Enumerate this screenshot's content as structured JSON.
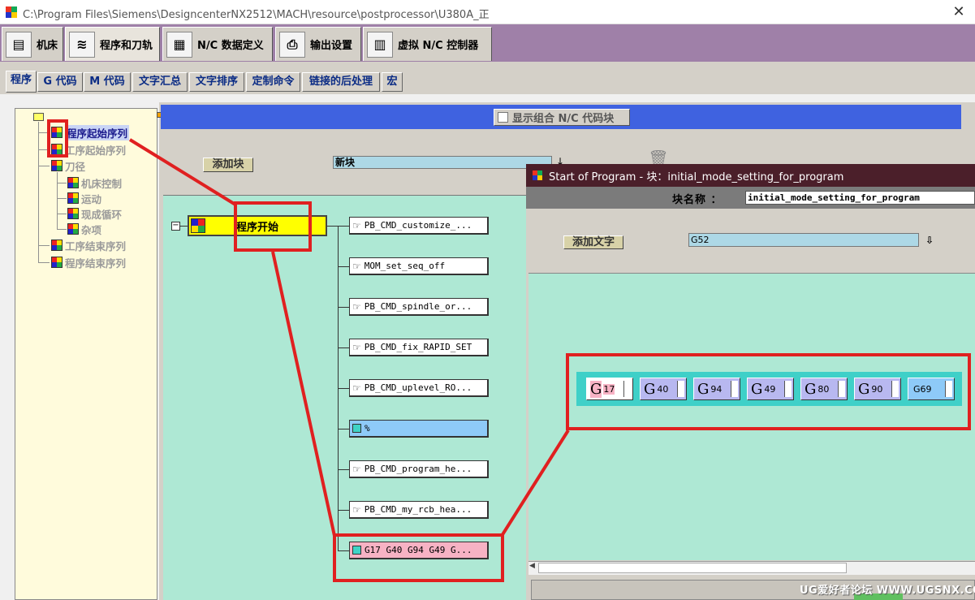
{
  "window": {
    "title": "C:\\Program Files\\Siemens\\DesigncenterNX2512\\MACH\\resource\\postprocessor\\U380A_正",
    "close": "✕"
  },
  "main_tabs": [
    {
      "label": "机床",
      "icon": "machine-icon"
    },
    {
      "label": "程序和刀轨",
      "icon": "program-path-icon"
    },
    {
      "label": "N/C 数据定义",
      "icon": "nc-data-icon"
    },
    {
      "label": "输出设置",
      "icon": "printer-icon"
    },
    {
      "label": "虚拟 N/C 控制器",
      "icon": "virtual-controller-icon"
    }
  ],
  "sub_tabs": [
    "程序",
    "G 代码",
    "M 代码",
    "文字汇总",
    "文字排序",
    "定制命令",
    "链接的后处理",
    "宏"
  ],
  "tree": {
    "items": [
      "程序起始序列",
      "工序起始序列",
      "刀径",
      "机床控制",
      "运动",
      "现成循环",
      "杂项",
      "工序结束序列",
      "程序结束序列"
    ]
  },
  "toolbar": {
    "combo_checkbox_label": "显示组合 N/C 代码块",
    "add_block_label": "添加块",
    "new_block_value": "新块",
    "dropdown_arrow": "↓"
  },
  "sequence": {
    "root_label": "程序开始",
    "collapse": "⊟",
    "blocks": [
      "PB_CMD_customize_...",
      "MOM_set_seq_off",
      "PB_CMD_spindle_or...",
      "PB_CMD_fix_RAPID_SET",
      "PB_CMD_uplevel_RO...",
      "%",
      "PB_CMD_program_he...",
      "PB_CMD_my_rcb_hea...",
      "G17 G40 G94 G49 G..."
    ]
  },
  "popup": {
    "title": "Start of Program  -  块：initial_mode_setting_for_program",
    "block_name_label": "块名称  ：",
    "block_name_value": "initial_mode_setting_for_program",
    "add_text_label": "添加文字",
    "text_value": "G52",
    "dropdown_arrow": "⇩",
    "scroll_left": "◀",
    "words": [
      {
        "letter": "G",
        "value": "17"
      },
      {
        "letter": "G",
        "value": "40"
      },
      {
        "letter": "G",
        "value": "94"
      },
      {
        "letter": "G",
        "value": "49"
      },
      {
        "letter": "G",
        "value": "80"
      },
      {
        "letter": "G",
        "value": "90"
      },
      {
        "letter": "",
        "value": "G69"
      }
    ]
  },
  "watermark": "UG爱好者论坛 WWW.UGSNX.COM",
  "colors": {
    "tab_strip": "#9f80a8",
    "header_blue": "#3f62e0",
    "canvas_green": "#aee8d4",
    "root_yellow": "#ffff00",
    "annotation_red": "#e02020",
    "popup_title": "#4b1f2a"
  }
}
